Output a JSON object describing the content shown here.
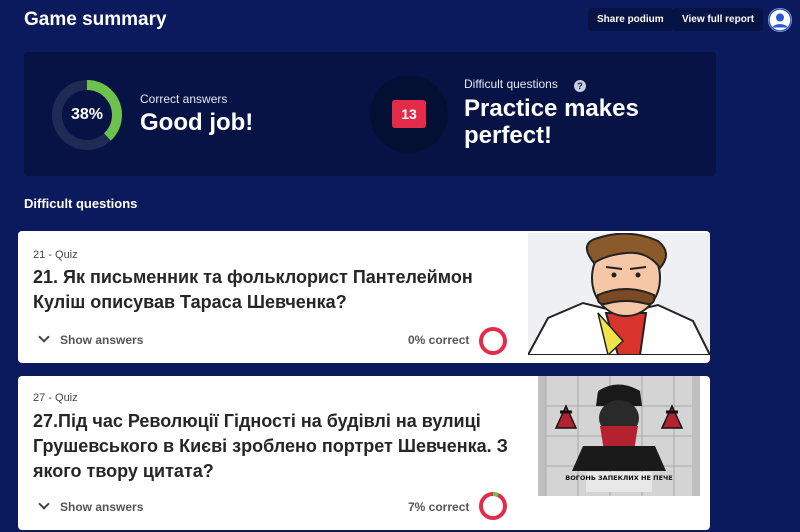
{
  "header": {
    "title": "Game summary",
    "share_label": "Share podium",
    "report_label": "View full report"
  },
  "summary": {
    "correct": {
      "percent_label": "38%",
      "percent_value": 38,
      "label": "Correct answers",
      "message": "Good job!",
      "ring_color": "#6cc24a"
    },
    "difficult": {
      "count": "13",
      "label": "Difficult questions",
      "help_glyph": "?",
      "message": "Practice makes perfect!",
      "badge_color": "#e42c4a"
    }
  },
  "section_title": "Difficult questions",
  "questions": [
    {
      "meta": "21 - Quiz",
      "text": "21. Як письменник та фольклорист Пантелеймон Куліш описував Тараса Шевченка?",
      "show_answers": "Show answers",
      "correct_label": "0% correct",
      "correct_value": 0
    },
    {
      "meta": "27 - Quiz",
      "text": "27.Під час Революції Гідності на будівлі на вулиці Грушевського в Києві зроблено портрет Шевченка. З якого твору цитата?",
      "show_answers": "Show answers",
      "correct_label": "7% correct",
      "correct_value": 7,
      "image_caption": "ВОГОНЬ ЗАПЕКЛИХ НЕ ПЕЧЕ"
    }
  ],
  "colors": {
    "background": "#0a1a5c",
    "panel": "#071245",
    "correct_green": "#6cc24a",
    "wrong_red": "#e42c4a"
  }
}
